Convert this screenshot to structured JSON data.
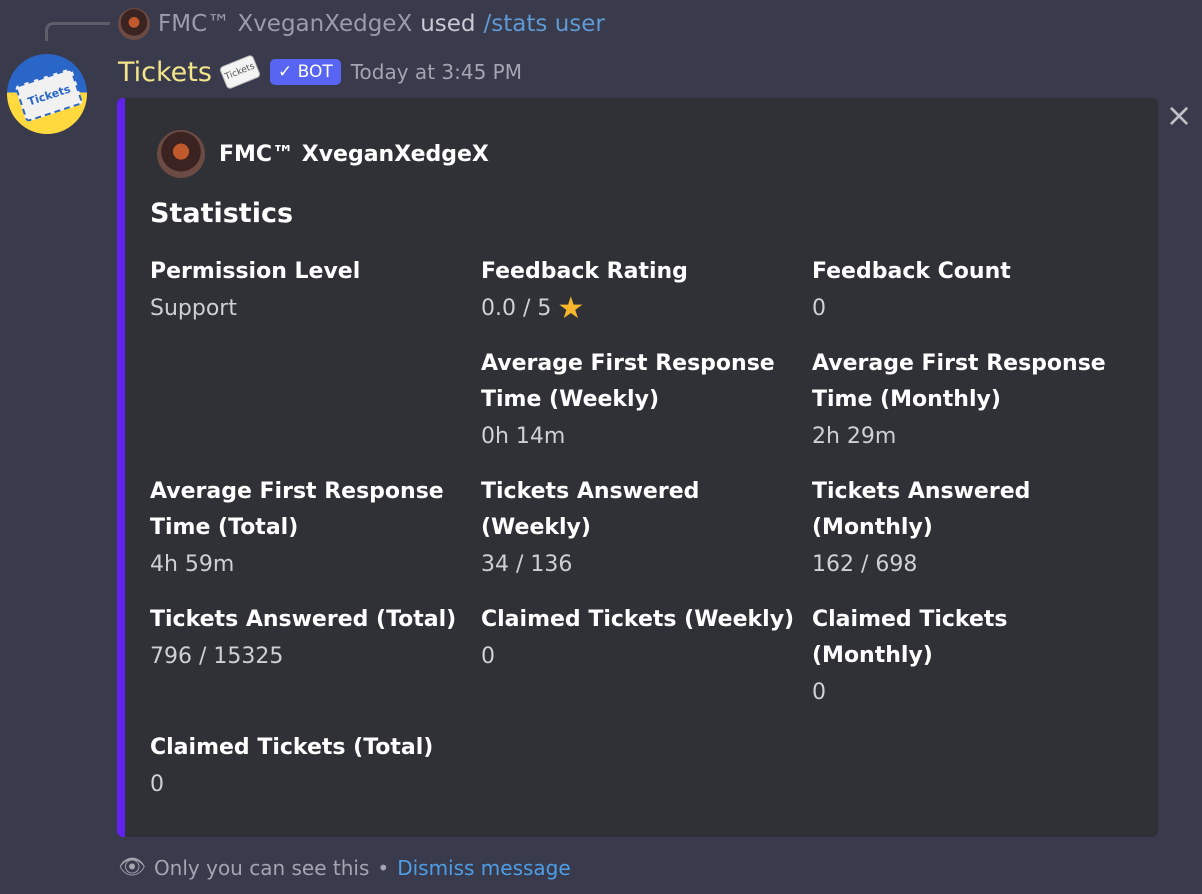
{
  "reply": {
    "username": "FMC™ XveganXedgeX",
    "used_text": "used",
    "command": "/stats user"
  },
  "message": {
    "bot_name": "Tickets",
    "bot_badge": "✓ BOT",
    "timestamp": "Today at 3:45 PM",
    "avatar_text": "Tickets",
    "emoji_text": "Tickets"
  },
  "embed": {
    "accent_color": "#6122ed",
    "author": "FMC™ XveganXedgeX",
    "title": "Statistics",
    "close_icon": "×",
    "fields": [
      {
        "name": "Permission Level",
        "value": "Support"
      },
      {
        "name": "Feedback Rating",
        "value": "0.0 / 5",
        "icon": "star"
      },
      {
        "name": "Feedback Count",
        "value": "0"
      },
      {
        "name": "Average First Response Time (Weekly)",
        "value": "0h 14m"
      },
      {
        "name": "Average First Response Time (Monthly)",
        "value": "2h 29m"
      },
      {
        "name": "Average First Response Time (Total)",
        "value": "4h 59m"
      },
      {
        "name": "Tickets Answered (Weekly)",
        "value": "34 / 136"
      },
      {
        "name": "Tickets Answered (Monthly)",
        "value": "162 / 698"
      },
      {
        "name": "Tickets Answered (Total)",
        "value": "796 / 15325"
      },
      {
        "name": "Claimed Tickets (Weekly)",
        "value": "0"
      },
      {
        "name": "Claimed Tickets (Monthly)",
        "value": "0"
      },
      {
        "name": "Claimed Tickets (Total)",
        "value": "0"
      }
    ]
  },
  "footer": {
    "only_you": "Only you can see this",
    "separator": "•",
    "dismiss": "Dismiss message"
  }
}
